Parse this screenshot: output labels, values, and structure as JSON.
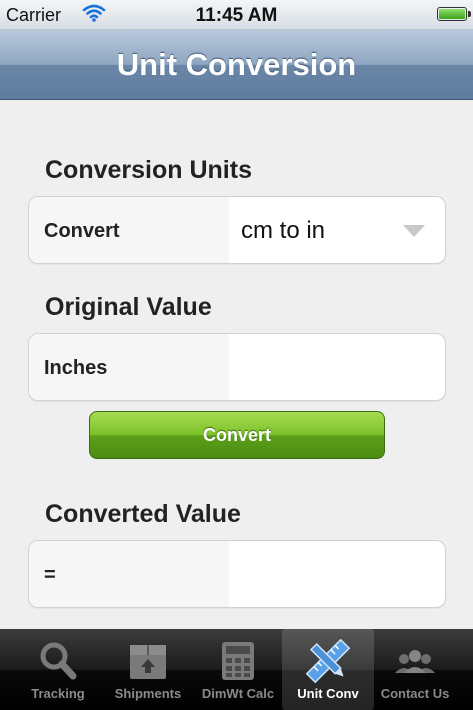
{
  "status_bar": {
    "carrier": "Carrier",
    "time": "11:45 AM"
  },
  "nav_bar": {
    "title": "Unit Conversion"
  },
  "conversion_units": {
    "section_title": "Conversion Units",
    "label": "Convert",
    "selected_value": "cm to in"
  },
  "original_value": {
    "section_title": "Original Value",
    "label": "Inches",
    "value": ""
  },
  "convert_button": {
    "label": "Convert"
  },
  "converted_value": {
    "section_title": "Converted Value",
    "label": "=",
    "value": ""
  },
  "tab_bar": {
    "tabs": [
      {
        "label": "Tracking",
        "icon": "magnifier-icon"
      },
      {
        "label": "Shipments",
        "icon": "box-icon"
      },
      {
        "label": "DimWt Calc",
        "icon": "calculator-icon"
      },
      {
        "label": "Unit Conv",
        "icon": "ruler-pencil-icon",
        "active": true
      },
      {
        "label": "Contact Us",
        "icon": "people-icon"
      }
    ]
  },
  "colors": {
    "nav_bar": "#7d96b4",
    "convert_button": "#6cb01f",
    "tab_bar": "#111111",
    "background": "#efefef"
  }
}
